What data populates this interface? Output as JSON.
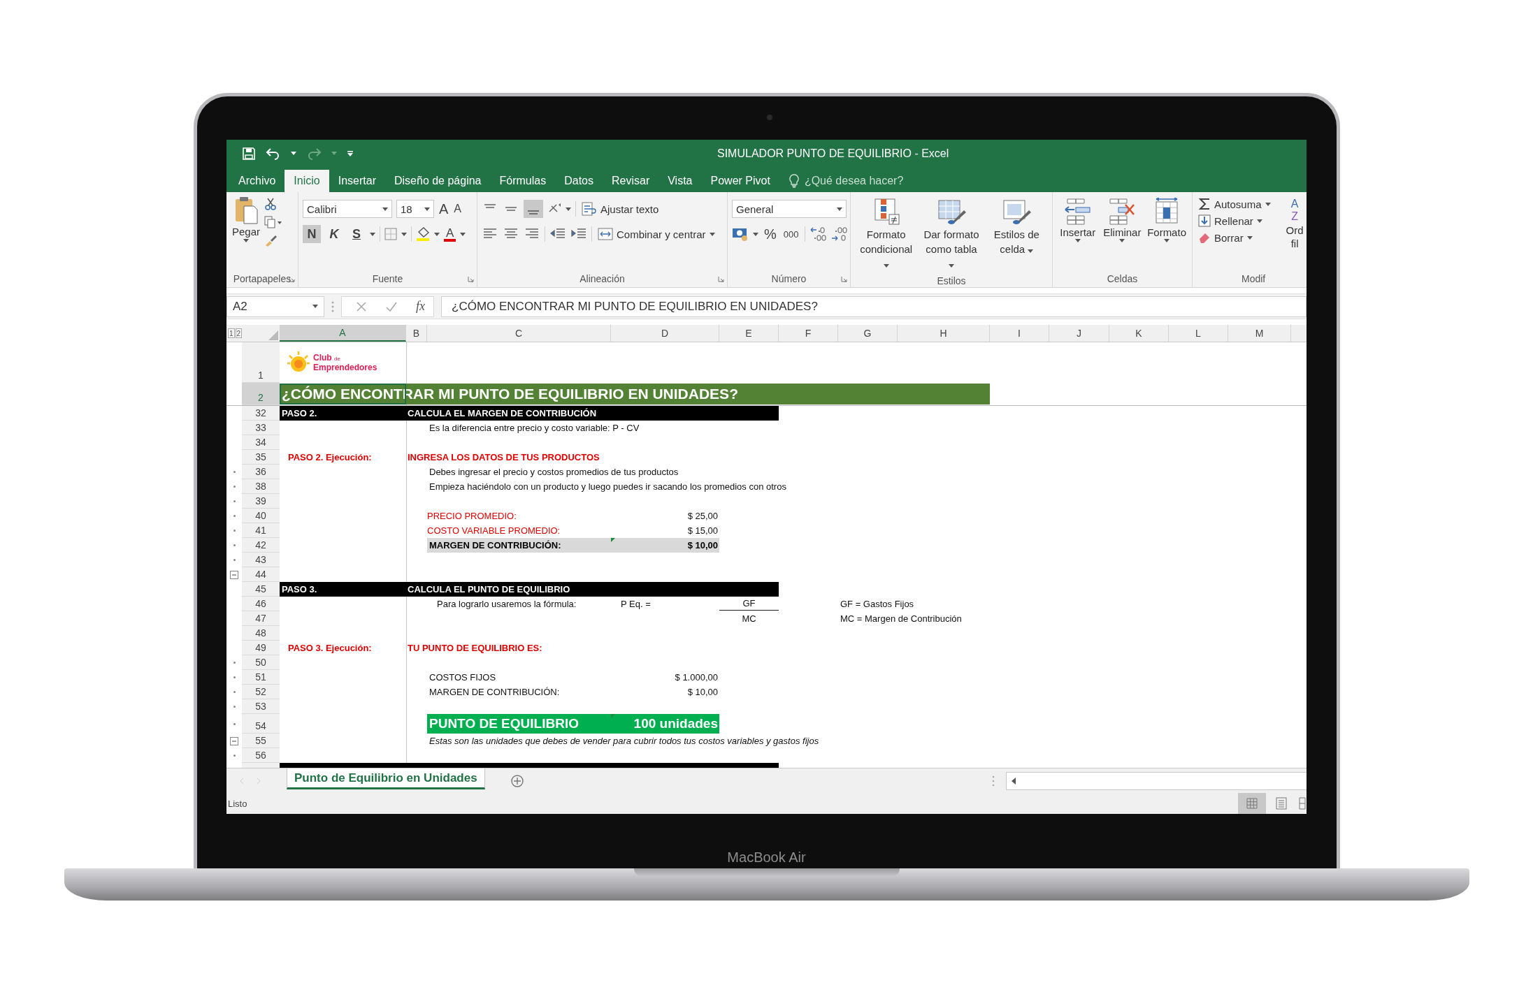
{
  "window": {
    "title": "SIMULADOR PUNTO DE EQUILIBRIO - Excel"
  },
  "tabs": [
    {
      "label": "Archivo",
      "selected": false
    },
    {
      "label": "Inicio",
      "selected": true
    },
    {
      "label": "Insertar",
      "selected": false
    },
    {
      "label": "Diseño de página",
      "selected": false
    },
    {
      "label": "Fórmulas",
      "selected": false
    },
    {
      "label": "Datos",
      "selected": false
    },
    {
      "label": "Revisar",
      "selected": false
    },
    {
      "label": "Vista",
      "selected": false
    },
    {
      "label": "Power Pivot",
      "selected": false
    }
  ],
  "tell_me": {
    "placeholder": "¿Qué desea hacer?"
  },
  "ribbon": {
    "clipboard": {
      "paste": "Pegar",
      "group": "Portapapeles"
    },
    "font": {
      "family": "Calibri",
      "size": "18",
      "grow": "A",
      "shrink": "A",
      "font_color_letter": "A",
      "group": "Fuente",
      "styles": [
        {
          "label": "N",
          "selected": true
        },
        {
          "label": "K",
          "selected": false
        },
        {
          "label": "S",
          "selected": false
        }
      ]
    },
    "alignment": {
      "wrap": "Ajustar texto",
      "merge": "Combinar y centrar",
      "group": "Alineación"
    },
    "number": {
      "format": "General",
      "percent": "%",
      "thousands": "000",
      "group": "Número"
    },
    "styles": {
      "buttons": [
        "Formato condicional",
        "Dar formato como tabla",
        "Estilos de celda"
      ],
      "group": "Estilos"
    },
    "cells": {
      "buttons": [
        "Insertar",
        "Eliminar",
        "Formato"
      ],
      "group": "Celdas"
    },
    "editing": {
      "buttons": [
        "Autosuma",
        "Rellenar",
        "Borrar"
      ],
      "sort_icon": [
        "A",
        "Z"
      ],
      "sort": [
        "Ord",
        "fil"
      ],
      "group": "Modif"
    }
  },
  "formula_bar": {
    "name_box": "A2",
    "function_label": "fx",
    "formula": "¿CÓMO ENCONTRAR MI PUNTO DE EQUILIBRIO EN UNIDADES?"
  },
  "outline_levels": [
    "1",
    "2"
  ],
  "columns": [
    {
      "label": "A",
      "selected": true
    },
    {
      "label": "B",
      "selected": false
    },
    {
      "label": "C",
      "selected": false
    },
    {
      "label": "D",
      "selected": false
    },
    {
      "label": "E",
      "selected": false
    },
    {
      "label": "F",
      "selected": false
    },
    {
      "label": "G",
      "selected": false
    },
    {
      "label": "H",
      "selected": false
    },
    {
      "label": "I",
      "selected": false
    },
    {
      "label": "J",
      "selected": false
    },
    {
      "label": "K",
      "selected": false
    },
    {
      "label": "L",
      "selected": false
    },
    {
      "label": "M",
      "selected": false
    }
  ],
  "logo": {
    "name": "Club",
    "small": "de",
    "name2": "Emprendedores"
  },
  "rows": [
    {
      "number": "1",
      "selected": false,
      "kind": "logo"
    },
    {
      "number": "2",
      "selected": true,
      "kind": "title",
      "text": "¿CÓMO ENCONTRAR MI PUNTO DE EQUILIBRIO EN UNIDADES?"
    },
    {
      "number": "32",
      "selected": false,
      "kind": "section",
      "label": "PASO 2.",
      "title": "CALCULA EL MARGEN DE CONTRIBUCIÓN"
    },
    {
      "number": "33",
      "selected": false,
      "kind": "cells",
      "cells": {
        "c": {
          "text": "Es la diferencia entre precio y costo variable: P - CV",
          "kind": "text"
        }
      }
    },
    {
      "number": "34",
      "selected": false,
      "kind": "cells",
      "cells": {}
    },
    {
      "number": "35",
      "selected": false,
      "kind": "cells",
      "cells": {
        "a": {
          "text": "PASO 2. Ejecución:",
          "kind": "label"
        },
        "b": {
          "text": "INGRESA LOS DATOS DE TUS PRODUCTOS",
          "kind": "heading"
        }
      }
    },
    {
      "number": "36",
      "selected": false,
      "kind": "cells",
      "grouped": true,
      "cells": {
        "c": {
          "text": "Debes ingresar el precio y costos promedios de tus productos",
          "kind": "text"
        }
      }
    },
    {
      "number": "38",
      "selected": false,
      "kind": "cells",
      "grouped": true,
      "cells": {
        "c": {
          "text": "Empieza haciéndolo con un producto y luego puedes ir sacando los promedios con otros",
          "kind": "text"
        }
      }
    },
    {
      "number": "39",
      "selected": false,
      "kind": "cells",
      "grouped": true,
      "cells": {}
    },
    {
      "number": "40",
      "selected": false,
      "kind": "cells",
      "grouped": true,
      "cells": {
        "c": {
          "text": "PRECIO PROMEDIO:",
          "kind": "note"
        },
        "d": {
          "text": "$ 25,00",
          "kind": "amount"
        }
      }
    },
    {
      "number": "41",
      "selected": false,
      "kind": "cells",
      "grouped": true,
      "cells": {
        "c": {
          "text": "COSTO VARIABLE PROMEDIO:",
          "kind": "note"
        },
        "d": {
          "text": "$ 15,00",
          "kind": "amount"
        }
      }
    },
    {
      "number": "42",
      "selected": false,
      "kind": "total",
      "grouped": true,
      "label": "MARGEN DE CONTRIBUCIÓN:",
      "value": "$ 10,00"
    },
    {
      "number": "43",
      "selected": false,
      "kind": "cells",
      "grouped": true,
      "cells": {}
    },
    {
      "number": "44",
      "selected": false,
      "kind": "cells",
      "collapse_button": true,
      "cells": {}
    },
    {
      "number": "45",
      "selected": false,
      "kind": "section",
      "label": "PASO 3.",
      "title": "CALCULA EL PUNTO DE EQUILIBRIO"
    },
    {
      "number": "46",
      "selected": false,
      "kind": "cells",
      "cells": {
        "c": {
          "text": "Para lograrlo usaremos la fórmula:",
          "kind": "indent"
        },
        "d": {
          "text": "P Eq.  =",
          "kind": "indent"
        },
        "e": {
          "text": "GF",
          "kind": "numerator"
        },
        "g": {
          "text": "GF = Gastos Fijos",
          "kind": "text"
        }
      }
    },
    {
      "number": "47",
      "selected": false,
      "kind": "cells",
      "cells": {
        "e": {
          "text": "MC",
          "kind": "denominator"
        },
        "g": {
          "text": "MC = Margen de Contribución",
          "kind": "text"
        }
      }
    },
    {
      "number": "48",
      "selected": false,
      "kind": "cells",
      "cells": {}
    },
    {
      "number": "49",
      "selected": false,
      "kind": "cells",
      "cells": {
        "a": {
          "text": "PASO 3. Ejecución:",
          "kind": "label"
        },
        "b": {
          "text": "TU PUNTO DE EQUILIBRIO ES:",
          "kind": "heading"
        }
      }
    },
    {
      "number": "50",
      "selected": false,
      "kind": "cells",
      "grouped": true,
      "cells": {}
    },
    {
      "number": "51",
      "selected": false,
      "kind": "cells",
      "grouped": true,
      "cells": {
        "c": {
          "text": "COSTOS FIJOS",
          "kind": "text"
        },
        "d": {
          "text": "$ 1.000,00",
          "kind": "amount"
        }
      }
    },
    {
      "number": "52",
      "selected": false,
      "kind": "cells",
      "grouped": true,
      "cells": {
        "c": {
          "text": "MARGEN DE CONTRIBUCIÓN:",
          "kind": "text"
        },
        "d": {
          "text": "$ 10,00",
          "kind": "amount"
        }
      }
    },
    {
      "number": "53",
      "selected": false,
      "kind": "cells",
      "grouped": true,
      "cells": {}
    },
    {
      "number": "54",
      "selected": false,
      "kind": "result",
      "grouped": true,
      "label": "PUNTO DE EQUILIBRIO",
      "value": "100 unidades"
    },
    {
      "number": "55",
      "selected": false,
      "kind": "cells",
      "collapse_button": true,
      "cells": {
        "c": {
          "text": "Estas son las unidades que debes de vender para cubrir todos tus costos variables y gastos fijos",
          "kind": "italic"
        }
      }
    },
    {
      "number": "56",
      "selected": false,
      "kind": "cells",
      "grouped": true,
      "cells": {}
    },
    {
      "selected": false,
      "kind": "section-cut"
    }
  ],
  "sheet_tabs": [
    {
      "label": "Punto de Equilibrio en Unidades",
      "selected": true
    }
  ],
  "status_bar": {
    "text": "Listo"
  },
  "device": {
    "label": "MacBook Air"
  }
}
